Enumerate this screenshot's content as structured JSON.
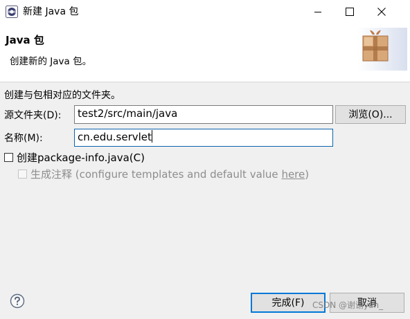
{
  "window": {
    "title": "新建 Java 包",
    "controls": [
      "minimize-icon",
      "maximize-icon",
      "close-icon"
    ]
  },
  "header": {
    "title": "Java 包",
    "description": "创建新的 Java 包。",
    "art_icon": "package-icon"
  },
  "form": {
    "intro": "创建与包相对应的文件夹。",
    "source_folder": {
      "label": "源文件夹(D):",
      "value": "test2/src/main/java",
      "browse_label": "浏览(O)..."
    },
    "name": {
      "label": "名称(M):",
      "value": "cn.edu.servlet"
    },
    "package_info": {
      "label": "创建package-info.java(C)",
      "checked": false
    },
    "generate_comments": {
      "label_prefix": "生成注释 (configure templates and default value ",
      "link": "here",
      "label_suffix": ")",
      "checked": false,
      "enabled": false
    }
  },
  "footer": {
    "help_icon": "help-icon",
    "finish_label": "完成(F)",
    "cancel_label": "取消"
  },
  "watermark": "CSDN @谢谢yan_",
  "colors": {
    "accent": "#0078d7",
    "field_border": "#7a7a7a",
    "disabled_text": "#8d8d8d"
  }
}
